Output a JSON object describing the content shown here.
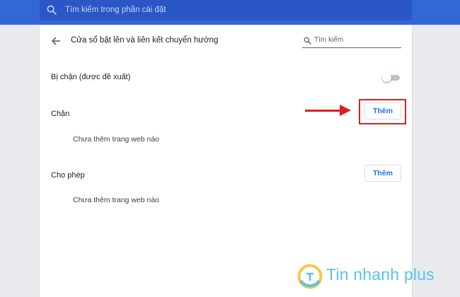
{
  "colors": {
    "header_blue": "#3367d6",
    "link_blue": "#1a73e8",
    "annotation_red": "#e01e1e",
    "watermark_blue": "#5ac2ef"
  },
  "header": {
    "search_placeholder": "Tìm kiếm trong phần cài đặt",
    "search_icon": "search-icon"
  },
  "page": {
    "back_icon": "arrow-left-icon",
    "title": "Cửa sổ bật lên và liên kết chuyển hướng",
    "search_placeholder": "Tìm kiếm"
  },
  "blocked_toggle": {
    "label": "Bị chặn (được đề xuất)",
    "enabled": false
  },
  "block_section": {
    "label": "Chặn",
    "add_button": "Thêm",
    "empty_text": "Chưa thêm trang web nào"
  },
  "allow_section": {
    "label": "Cho phép",
    "add_button": "Thêm",
    "empty_text": "Chưa thêm trang web nào"
  },
  "annotation": {
    "target": "block_section.add_button"
  },
  "watermark": {
    "text": "Tin nhanh plus"
  }
}
